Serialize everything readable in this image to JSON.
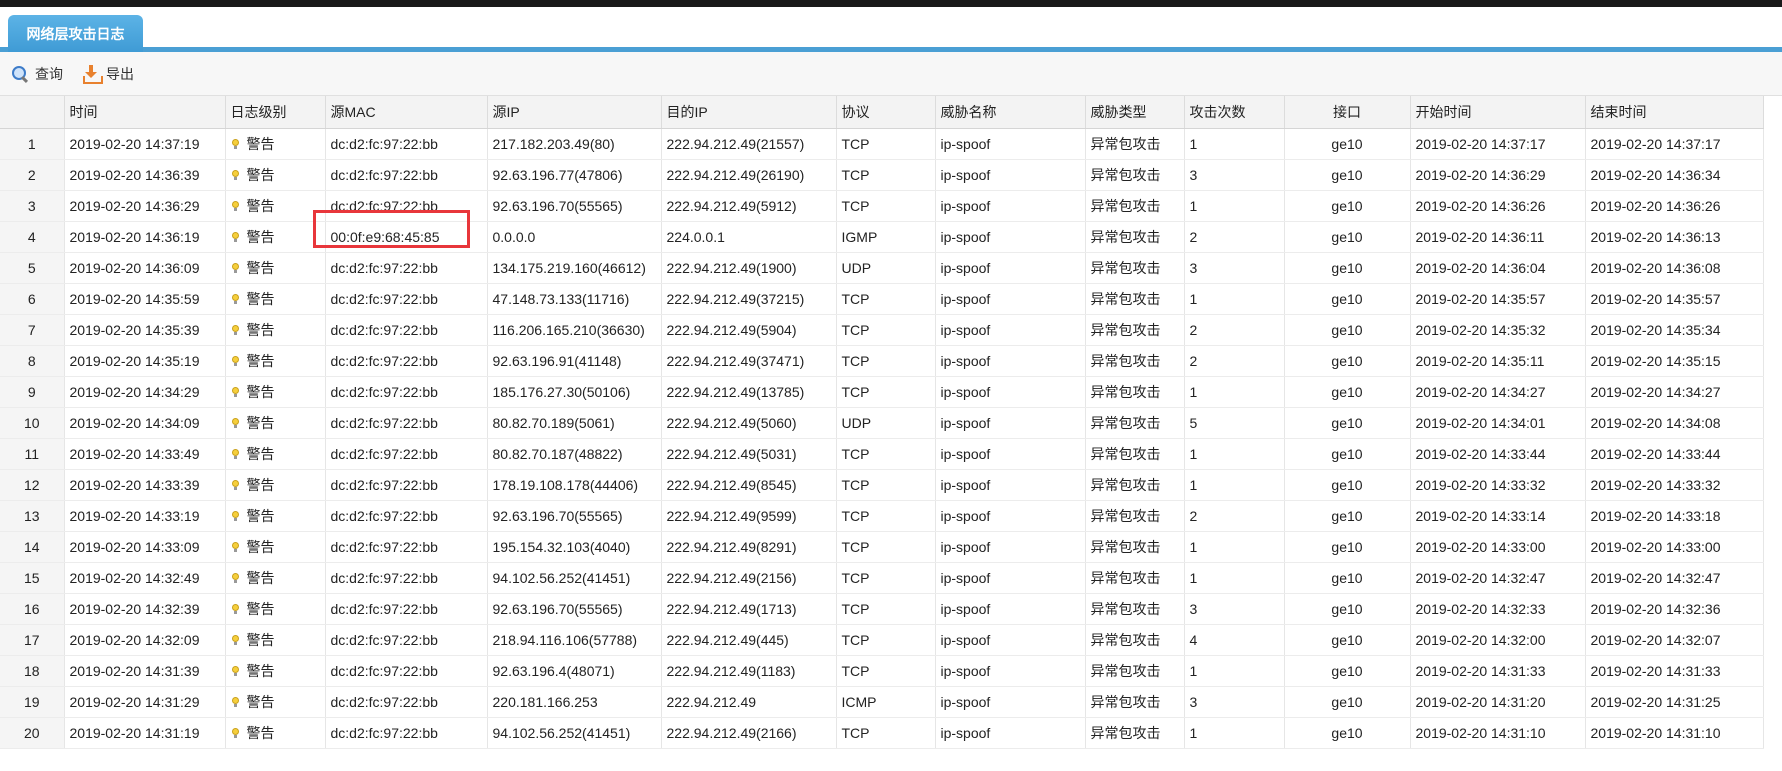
{
  "tab": {
    "label": "网络层攻击日志"
  },
  "toolbar": {
    "query_label": "查询",
    "export_label": "导出"
  },
  "columns": [
    "",
    "时间",
    "日志级别",
    "源MAC",
    "源IP",
    "目的IP",
    "协议",
    "威胁名称",
    "威胁类型",
    "攻击次数",
    "接口",
    "开始时间",
    "结束时间"
  ],
  "rows": [
    {
      "n": "1",
      "time": "2019-02-20 14:37:19",
      "level": "警告",
      "mac": "dc:d2:fc:97:22:bb",
      "src": "217.182.203.49(80)",
      "dst": "222.94.212.49(21557)",
      "proto": "TCP",
      "name": "ip-spoof",
      "type": "异常包攻击",
      "count": "1",
      "iface": "ge10",
      "start": "2019-02-20 14:37:17",
      "end": "2019-02-20 14:37:17"
    },
    {
      "n": "2",
      "time": "2019-02-20 14:36:39",
      "level": "警告",
      "mac": "dc:d2:fc:97:22:bb",
      "src": "92.63.196.77(47806)",
      "dst": "222.94.212.49(26190)",
      "proto": "TCP",
      "name": "ip-spoof",
      "type": "异常包攻击",
      "count": "3",
      "iface": "ge10",
      "start": "2019-02-20 14:36:29",
      "end": "2019-02-20 14:36:34"
    },
    {
      "n": "3",
      "time": "2019-02-20 14:36:29",
      "level": "警告",
      "mac": "dc:d2:fc:97:22:bb",
      "src": "92.63.196.70(55565)",
      "dst": "222.94.212.49(5912)",
      "proto": "TCP",
      "name": "ip-spoof",
      "type": "异常包攻击",
      "count": "1",
      "iface": "ge10",
      "start": "2019-02-20 14:36:26",
      "end": "2019-02-20 14:36:26"
    },
    {
      "n": "4",
      "time": "2019-02-20 14:36:19",
      "level": "警告",
      "mac": "00:0f:e9:68:45:85",
      "src": "0.0.0.0",
      "dst": "224.0.0.1",
      "proto": "IGMP",
      "name": "ip-spoof",
      "type": "异常包攻击",
      "count": "2",
      "iface": "ge10",
      "start": "2019-02-20 14:36:11",
      "end": "2019-02-20 14:36:13"
    },
    {
      "n": "5",
      "time": "2019-02-20 14:36:09",
      "level": "警告",
      "mac": "dc:d2:fc:97:22:bb",
      "src": "134.175.219.160(46612)",
      "dst": "222.94.212.49(1900)",
      "proto": "UDP",
      "name": "ip-spoof",
      "type": "异常包攻击",
      "count": "3",
      "iface": "ge10",
      "start": "2019-02-20 14:36:04",
      "end": "2019-02-20 14:36:08"
    },
    {
      "n": "6",
      "time": "2019-02-20 14:35:59",
      "level": "警告",
      "mac": "dc:d2:fc:97:22:bb",
      "src": "47.148.73.133(11716)",
      "dst": "222.94.212.49(37215)",
      "proto": "TCP",
      "name": "ip-spoof",
      "type": "异常包攻击",
      "count": "1",
      "iface": "ge10",
      "start": "2019-02-20 14:35:57",
      "end": "2019-02-20 14:35:57"
    },
    {
      "n": "7",
      "time": "2019-02-20 14:35:39",
      "level": "警告",
      "mac": "dc:d2:fc:97:22:bb",
      "src": "116.206.165.210(36630)",
      "dst": "222.94.212.49(5904)",
      "proto": "TCP",
      "name": "ip-spoof",
      "type": "异常包攻击",
      "count": "2",
      "iface": "ge10",
      "start": "2019-02-20 14:35:32",
      "end": "2019-02-20 14:35:34"
    },
    {
      "n": "8",
      "time": "2019-02-20 14:35:19",
      "level": "警告",
      "mac": "dc:d2:fc:97:22:bb",
      "src": "92.63.196.91(41148)",
      "dst": "222.94.212.49(37471)",
      "proto": "TCP",
      "name": "ip-spoof",
      "type": "异常包攻击",
      "count": "2",
      "iface": "ge10",
      "start": "2019-02-20 14:35:11",
      "end": "2019-02-20 14:35:15"
    },
    {
      "n": "9",
      "time": "2019-02-20 14:34:29",
      "level": "警告",
      "mac": "dc:d2:fc:97:22:bb",
      "src": "185.176.27.30(50106)",
      "dst": "222.94.212.49(13785)",
      "proto": "TCP",
      "name": "ip-spoof",
      "type": "异常包攻击",
      "count": "1",
      "iface": "ge10",
      "start": "2019-02-20 14:34:27",
      "end": "2019-02-20 14:34:27"
    },
    {
      "n": "10",
      "time": "2019-02-20 14:34:09",
      "level": "警告",
      "mac": "dc:d2:fc:97:22:bb",
      "src": "80.82.70.189(5061)",
      "dst": "222.94.212.49(5060)",
      "proto": "UDP",
      "name": "ip-spoof",
      "type": "异常包攻击",
      "count": "5",
      "iface": "ge10",
      "start": "2019-02-20 14:34:01",
      "end": "2019-02-20 14:34:08"
    },
    {
      "n": "11",
      "time": "2019-02-20 14:33:49",
      "level": "警告",
      "mac": "dc:d2:fc:97:22:bb",
      "src": "80.82.70.187(48822)",
      "dst": "222.94.212.49(5031)",
      "proto": "TCP",
      "name": "ip-spoof",
      "type": "异常包攻击",
      "count": "1",
      "iface": "ge10",
      "start": "2019-02-20 14:33:44",
      "end": "2019-02-20 14:33:44"
    },
    {
      "n": "12",
      "time": "2019-02-20 14:33:39",
      "level": "警告",
      "mac": "dc:d2:fc:97:22:bb",
      "src": "178.19.108.178(44406)",
      "dst": "222.94.212.49(8545)",
      "proto": "TCP",
      "name": "ip-spoof",
      "type": "异常包攻击",
      "count": "1",
      "iface": "ge10",
      "start": "2019-02-20 14:33:32",
      "end": "2019-02-20 14:33:32"
    },
    {
      "n": "13",
      "time": "2019-02-20 14:33:19",
      "level": "警告",
      "mac": "dc:d2:fc:97:22:bb",
      "src": "92.63.196.70(55565)",
      "dst": "222.94.212.49(9599)",
      "proto": "TCP",
      "name": "ip-spoof",
      "type": "异常包攻击",
      "count": "2",
      "iface": "ge10",
      "start": "2019-02-20 14:33:14",
      "end": "2019-02-20 14:33:18"
    },
    {
      "n": "14",
      "time": "2019-02-20 14:33:09",
      "level": "警告",
      "mac": "dc:d2:fc:97:22:bb",
      "src": "195.154.32.103(4040)",
      "dst": "222.94.212.49(8291)",
      "proto": "TCP",
      "name": "ip-spoof",
      "type": "异常包攻击",
      "count": "1",
      "iface": "ge10",
      "start": "2019-02-20 14:33:00",
      "end": "2019-02-20 14:33:00"
    },
    {
      "n": "15",
      "time": "2019-02-20 14:32:49",
      "level": "警告",
      "mac": "dc:d2:fc:97:22:bb",
      "src": "94.102.56.252(41451)",
      "dst": "222.94.212.49(2156)",
      "proto": "TCP",
      "name": "ip-spoof",
      "type": "异常包攻击",
      "count": "1",
      "iface": "ge10",
      "start": "2019-02-20 14:32:47",
      "end": "2019-02-20 14:32:47"
    },
    {
      "n": "16",
      "time": "2019-02-20 14:32:39",
      "level": "警告",
      "mac": "dc:d2:fc:97:22:bb",
      "src": "92.63.196.70(55565)",
      "dst": "222.94.212.49(1713)",
      "proto": "TCP",
      "name": "ip-spoof",
      "type": "异常包攻击",
      "count": "3",
      "iface": "ge10",
      "start": "2019-02-20 14:32:33",
      "end": "2019-02-20 14:32:36"
    },
    {
      "n": "17",
      "time": "2019-02-20 14:32:09",
      "level": "警告",
      "mac": "dc:d2:fc:97:22:bb",
      "src": "218.94.116.106(57788)",
      "dst": "222.94.212.49(445)",
      "proto": "TCP",
      "name": "ip-spoof",
      "type": "异常包攻击",
      "count": "4",
      "iface": "ge10",
      "start": "2019-02-20 14:32:00",
      "end": "2019-02-20 14:32:07"
    },
    {
      "n": "18",
      "time": "2019-02-20 14:31:39",
      "level": "警告",
      "mac": "dc:d2:fc:97:22:bb",
      "src": "92.63.196.4(48071)",
      "dst": "222.94.212.49(1183)",
      "proto": "TCP",
      "name": "ip-spoof",
      "type": "异常包攻击",
      "count": "1",
      "iface": "ge10",
      "start": "2019-02-20 14:31:33",
      "end": "2019-02-20 14:31:33"
    },
    {
      "n": "19",
      "time": "2019-02-20 14:31:29",
      "level": "警告",
      "mac": "dc:d2:fc:97:22:bb",
      "src": "220.181.166.253",
      "dst": "222.94.212.49",
      "proto": "ICMP",
      "name": "ip-spoof",
      "type": "异常包攻击",
      "count": "3",
      "iface": "ge10",
      "start": "2019-02-20 14:31:20",
      "end": "2019-02-20 14:31:25"
    },
    {
      "n": "20",
      "time": "2019-02-20 14:31:19",
      "level": "警告",
      "mac": "dc:d2:fc:97:22:bb",
      "src": "94.102.56.252(41451)",
      "dst": "222.94.212.49(2166)",
      "proto": "TCP",
      "name": "ip-spoof",
      "type": "异常包攻击",
      "count": "1",
      "iface": "ge10",
      "start": "2019-02-20 14:31:10",
      "end": "2019-02-20 14:31:10"
    }
  ],
  "colors": {
    "accent": "#4a9fd4",
    "highlight": "#e8363b",
    "bulb": "#f6cf3c"
  }
}
